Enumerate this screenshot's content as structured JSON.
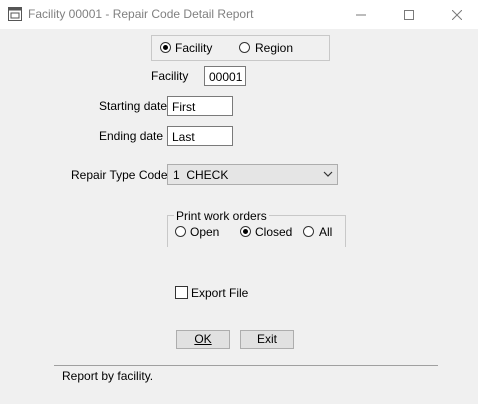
{
  "window": {
    "title": "Facility 00001 - Repair Code Detail Report",
    "icons": {
      "app": "report-window-icon",
      "minimize": "minimize-icon",
      "maximize": "maximize-icon",
      "close": "close-icon"
    }
  },
  "scope": {
    "facility_label": "Facility",
    "region_label": "Region",
    "selected": "Facility"
  },
  "form": {
    "facility_label": "Facility",
    "facility_value": "00001",
    "starting_date_label": "Starting date",
    "starting_date_value": "First",
    "ending_date_label": "Ending date",
    "ending_date_value": "Last",
    "repair_type_label": "Repair Type Code",
    "repair_type_value": "1  CHECK"
  },
  "print_work_orders": {
    "legend": "Print work orders",
    "open_label": "Open",
    "closed_label": "Closed",
    "all_label": "All",
    "selected": "Closed"
  },
  "export": {
    "label": "Export File",
    "checked": false
  },
  "buttons": {
    "ok_label": "OK",
    "exit_label": "Exit"
  },
  "status": {
    "text": "Report by facility."
  }
}
